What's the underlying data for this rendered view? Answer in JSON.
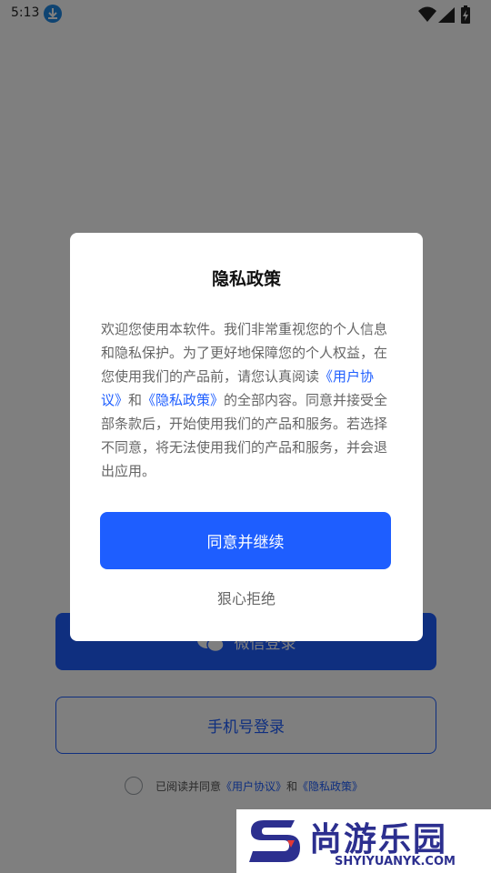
{
  "status_bar": {
    "time": "5:13",
    "icons": [
      "download-icon",
      "wifi-icon",
      "signal-icon",
      "battery-icon"
    ]
  },
  "background_page": {
    "wechat_login_label": "微信登录",
    "phone_login_label": "手机号登录",
    "agreement": {
      "prefix": "已阅读并同意",
      "user_agreement": "《用户协议》",
      "and": "和",
      "privacy_policy": "《隐私政策》"
    }
  },
  "dialog": {
    "title": "隐私政策",
    "body": {
      "part1": "欢迎您使用本软件。我们非常重视您的个人信息和隐私保护。为了更好地保障您的个人权益，在您使用我们的产品前，请您认真阅读",
      "user_agreement": "《用户协议》",
      "and": "和",
      "privacy_policy": "《隐私政策》",
      "part2": "的全部内容。同意并接受全部条款后，开始使用我们的产品和服务。若选择不同意，将无法使用我们的产品和服务，并会退出应用。"
    },
    "agree_label": "同意并继续",
    "reject_label": "狠心拒绝"
  },
  "watermark": {
    "title": "尚游乐园",
    "subtitle": "SHYIYUANYK.COM"
  },
  "colors": {
    "accent": "#1e5eff",
    "overlay": "rgba(0,0,0,0.5)",
    "watermark": "#2c2f8f"
  }
}
